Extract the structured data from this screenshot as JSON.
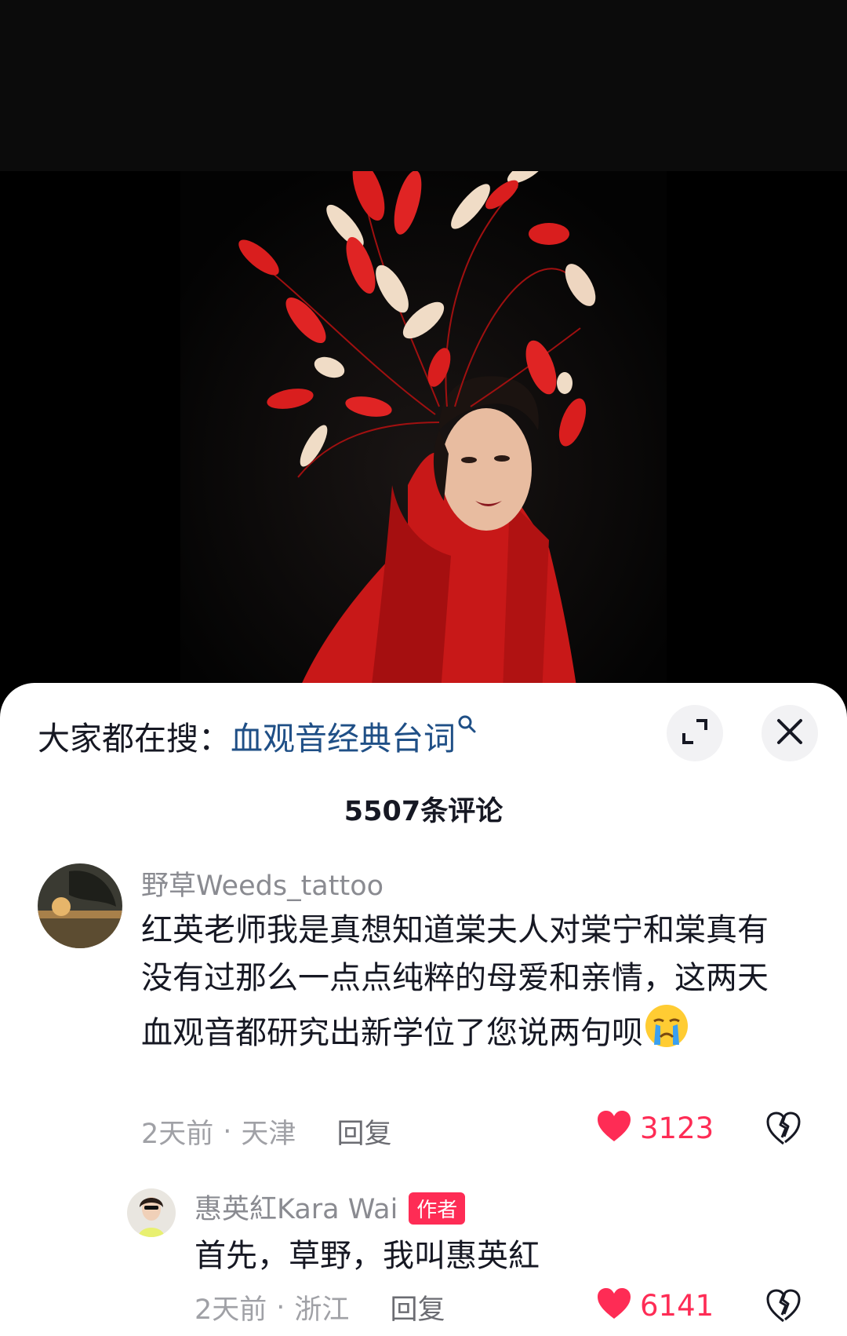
{
  "search": {
    "prefix": "大家都在搜：",
    "term": "血观音经典台词",
    "search_icon": "search-icon"
  },
  "controls": {
    "expand_icon": "expand-icon",
    "close_icon": "close-icon"
  },
  "comments_header": {
    "count_label": "5507条评论"
  },
  "comments": [
    {
      "username": "野草Weeds_tattoo",
      "text": "红英老师我是真想知道棠夫人对棠宁和棠真有没有过那么一点点纯粹的母爱和亲情，这两天血观音都研究出新学位了您说两句呗",
      "emoji": "crying-face-emoji",
      "time": "2天前",
      "location": "天津",
      "reply_label": "回复",
      "likes": "3123"
    }
  ],
  "replies": [
    {
      "username": "惠英紅Kara Wai",
      "badge": "作者",
      "text": "首先，草野，我叫惠英紅",
      "time": "2天前",
      "location": "浙江",
      "reply_label": "回复",
      "likes": "6141"
    }
  ],
  "colors": {
    "accent_red": "#fe2c55",
    "search_blue": "#1f4f86"
  }
}
